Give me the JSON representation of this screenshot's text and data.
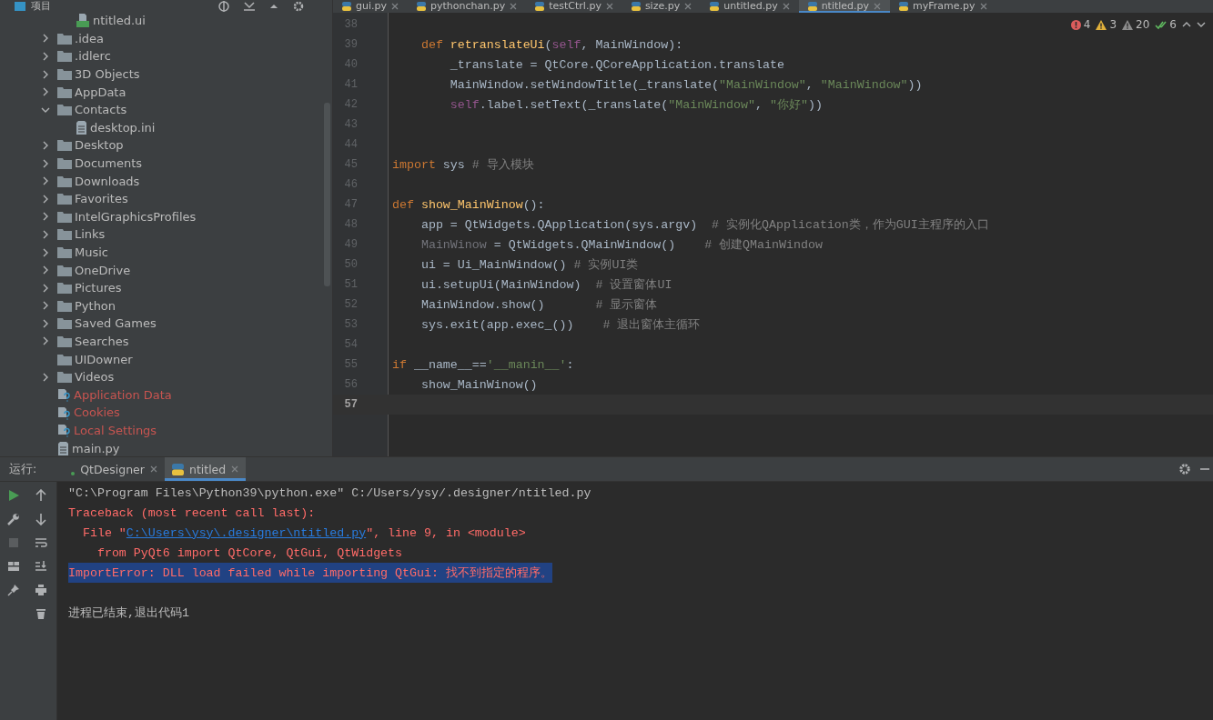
{
  "project_panel": {
    "title": "项目"
  },
  "project_tree": {
    "clipped_children": [
      {
        "label": "ntitled.ui",
        "kind": "qt-file"
      }
    ],
    "items": [
      {
        "label": ".idea",
        "kind": "folder",
        "expanded": false
      },
      {
        "label": ".idlerc",
        "kind": "folder",
        "expanded": false
      },
      {
        "label": "3D Objects",
        "kind": "folder",
        "expanded": false
      },
      {
        "label": "AppData",
        "kind": "folder",
        "expanded": false
      },
      {
        "label": "Contacts",
        "kind": "folder",
        "expanded": true,
        "children": [
          {
            "label": "desktop.ini",
            "kind": "text-file"
          }
        ]
      },
      {
        "label": "Desktop",
        "kind": "folder",
        "expanded": false
      },
      {
        "label": "Documents",
        "kind": "folder",
        "expanded": false
      },
      {
        "label": "Downloads",
        "kind": "folder",
        "expanded": false
      },
      {
        "label": "Favorites",
        "kind": "folder",
        "expanded": false
      },
      {
        "label": "IntelGraphicsProfiles",
        "kind": "folder",
        "expanded": false
      },
      {
        "label": "Links",
        "kind": "folder",
        "expanded": false
      },
      {
        "label": "Music",
        "kind": "folder",
        "expanded": false
      },
      {
        "label": "OneDrive",
        "kind": "folder",
        "expanded": false
      },
      {
        "label": "Pictures",
        "kind": "folder",
        "expanded": false
      },
      {
        "label": "Python",
        "kind": "folder",
        "expanded": false
      },
      {
        "label": "Saved Games",
        "kind": "folder",
        "expanded": false
      },
      {
        "label": "Searches",
        "kind": "folder",
        "expanded": false
      },
      {
        "label": "UIDowner",
        "kind": "leaf-folder"
      },
      {
        "label": "Videos",
        "kind": "folder",
        "expanded": false
      },
      {
        "label": "Application Data",
        "kind": "unversioned"
      },
      {
        "label": "Cookies",
        "kind": "unversioned"
      },
      {
        "label": "Local Settings",
        "kind": "unversioned"
      },
      {
        "label": "main.py",
        "kind": "text-file"
      }
    ]
  },
  "editor_tabs": [
    {
      "label": "gui.py",
      "selected": false
    },
    {
      "label": "pythonchan.py",
      "selected": false
    },
    {
      "label": "testCtrl.py",
      "selected": false
    },
    {
      "label": "size.py",
      "selected": false
    },
    {
      "label": "untitled.py",
      "selected": false
    },
    {
      "label": "ntitled.py",
      "selected": true
    },
    {
      "label": "myFrame.py",
      "selected": false
    }
  ],
  "inspections": [
    {
      "kind": "error",
      "count": "4"
    },
    {
      "kind": "warning",
      "count": "3"
    },
    {
      "kind": "weak-warning",
      "count": "20"
    },
    {
      "kind": "ok",
      "count": "6"
    }
  ],
  "code_lines": [
    {
      "number": "38",
      "current": false
    },
    {
      "number": "39",
      "current": false,
      "segments": [
        {
          "kind": "keyword",
          "text": "    def "
        },
        {
          "kind": "func",
          "text": "retranslateUi"
        },
        {
          "kind": "plain",
          "text": "("
        },
        {
          "kind": "self",
          "text": "self"
        },
        {
          "kind": "plain",
          "text": ", MainWindow):"
        }
      ]
    },
    {
      "number": "40",
      "current": false,
      "segments": [
        {
          "kind": "plain",
          "text": "        _translate = QtCore.QCoreApplication.translate"
        }
      ]
    },
    {
      "number": "41",
      "current": false,
      "segments": [
        {
          "kind": "plain",
          "text": "        MainWindow.setWindowTitle(_translate("
        },
        {
          "kind": "string",
          "text": "\"MainWindow\""
        },
        {
          "kind": "plain",
          "text": ", "
        },
        {
          "kind": "string",
          "text": "\"MainWindow\""
        },
        {
          "kind": "plain",
          "text": "))"
        }
      ]
    },
    {
      "number": "42",
      "current": false,
      "segments": [
        {
          "kind": "self",
          "text": "        self"
        },
        {
          "kind": "plain",
          "text": ".label.setText(_translate("
        },
        {
          "kind": "string",
          "text": "\"MainWindow\""
        },
        {
          "kind": "plain",
          "text": ", "
        },
        {
          "kind": "string",
          "text": "\"你好\""
        },
        {
          "kind": "plain",
          "text": "))"
        }
      ]
    },
    {
      "number": "43",
      "current": false
    },
    {
      "number": "44",
      "current": false
    },
    {
      "number": "45",
      "current": false,
      "segments": [
        {
          "kind": "keyword",
          "text": "import"
        },
        {
          "kind": "plain",
          "text": " sys "
        },
        {
          "kind": "comment",
          "text": "# 导入模块"
        }
      ]
    },
    {
      "number": "46",
      "current": false
    },
    {
      "number": "47",
      "current": false,
      "segments": [
        {
          "kind": "keyword",
          "text": "def "
        },
        {
          "kind": "func",
          "text": "show_MainWinow"
        },
        {
          "kind": "plain",
          "text": "():"
        }
      ]
    },
    {
      "number": "48",
      "current": false,
      "segments": [
        {
          "kind": "plain",
          "text": "    app = QtWidgets.QApplication(sys.argv)  "
        },
        {
          "kind": "comment",
          "text": "# 实例化QApplication类，作为GUI主程序的入口"
        }
      ]
    },
    {
      "number": "49",
      "current": false,
      "segments": [
        {
          "kind": "unused",
          "text": "    MainWinow"
        },
        {
          "kind": "plain",
          "text": " = QtWidgets.QMainWindow()    "
        },
        {
          "kind": "comment",
          "text": "# 创建QMainWindow"
        }
      ]
    },
    {
      "number": "50",
      "current": false,
      "segments": [
        {
          "kind": "plain",
          "text": "    ui = Ui_MainWindow() "
        },
        {
          "kind": "comment",
          "text": "# 实例UI类"
        }
      ]
    },
    {
      "number": "51",
      "current": false,
      "segments": [
        {
          "kind": "plain",
          "text": "    ui.setupUi(MainWindow)  "
        },
        {
          "kind": "comment",
          "text": "# 设置窗体UI"
        }
      ]
    },
    {
      "number": "52",
      "current": false,
      "segments": [
        {
          "kind": "plain",
          "text": "    MainWindow.show()       "
        },
        {
          "kind": "comment",
          "text": "# 显示窗体"
        }
      ]
    },
    {
      "number": "53",
      "current": false,
      "segments": [
        {
          "kind": "plain",
          "text": "    sys.exit(app.exec_())    "
        },
        {
          "kind": "comment",
          "text": "# 退出窗体主循环"
        }
      ]
    },
    {
      "number": "54",
      "current": false
    },
    {
      "number": "55",
      "current": false,
      "segments": [
        {
          "kind": "keyword",
          "text": "if"
        },
        {
          "kind": "plain",
          "text": " __name__=="
        },
        {
          "kind": "string",
          "text": "'__manin__'"
        },
        {
          "kind": "plain",
          "text": ":"
        }
      ]
    },
    {
      "number": "56",
      "current": false,
      "segments": [
        {
          "kind": "plain",
          "text": "    show_MainWinow()"
        }
      ]
    },
    {
      "number": "57",
      "current": true
    }
  ],
  "run_panel": {
    "label": "运行:",
    "tabs": [
      {
        "label": "QtDesigner",
        "selected": false
      },
      {
        "label": "ntitled",
        "selected": true
      }
    ]
  },
  "console_lines": [
    {
      "selected": false,
      "segments": [
        {
          "kind": "plain",
          "text": "\"C:\\Program Files\\Python39\\python.exe\" C:/Users/ysy/.designer/ntitled.py"
        }
      ]
    },
    {
      "selected": false,
      "segments": [
        {
          "kind": "error",
          "text": "Traceback (most recent call last):"
        }
      ]
    },
    {
      "selected": false,
      "segments": [
        {
          "kind": "error",
          "text": "  File \""
        },
        {
          "kind": "link",
          "text": "C:\\Users\\ysy\\.designer\\ntitled.py"
        },
        {
          "kind": "error",
          "text": "\", line 9, in <module>"
        }
      ]
    },
    {
      "selected": false,
      "segments": [
        {
          "kind": "error",
          "text": "    from PyQt6 import QtCore, QtGui, QtWidgets"
        }
      ]
    },
    {
      "selected": true,
      "segments": [
        {
          "kind": "error",
          "text": "ImportError: DLL load failed while importing QtGui: 找不到指定的程序。"
        }
      ]
    },
    {
      "selected": false
    },
    {
      "selected": false,
      "segments": [
        {
          "kind": "plain",
          "text": "进程已结束,退出代码1"
        }
      ]
    }
  ]
}
